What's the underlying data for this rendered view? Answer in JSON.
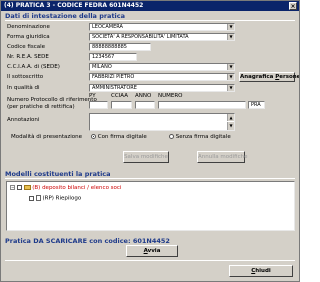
{
  "window": {
    "title": "(4) PRATICA 3 - CODICE FEDRA 601N4452",
    "close_glyph": "×"
  },
  "section_intestazione": {
    "title": "Dati di intestazione della pratica"
  },
  "form": {
    "denominazione": {
      "label": "Denominazione",
      "value": "LEOCAMERA"
    },
    "forma_giuridica": {
      "label": "Forma giuridica",
      "value": "SOCIETA' A RESPONSABILITA' LIMITATA"
    },
    "codice_fiscale": {
      "label": "Codice fiscale",
      "value": "88888888885"
    },
    "rea": {
      "label": "Nr. R.E.A. SEDE",
      "value": "1234567"
    },
    "cciaa": {
      "label": "C.C.I.A.A. di (SEDE)",
      "value": "MILANO"
    },
    "sottoscrittore": {
      "label": "Il sottoscritto",
      "value": "FABBRIZI PIETRO"
    },
    "qualita": {
      "label": "In qualità di",
      "value": "AMMINISTRATORE"
    },
    "protocollo": {
      "label_line1": "Numero Protocollo di riferimento",
      "label_line2": "(per pratiche di rettifica)",
      "col_py": "PY",
      "col_cciaa": "CCIAA",
      "col_anno": "ANNO",
      "col_numero": "NUMERO",
      "type_value": "PRA"
    },
    "annotazioni": {
      "label": "Annotazioni",
      "value": ""
    },
    "modalita": {
      "label": "Modalità di presentazione",
      "opt_firma": "Con firma digitale",
      "opt_senza": "Senza firma digitale",
      "selected": "Con firma digitale"
    }
  },
  "buttons": {
    "anagrafica": {
      "text_before": "Anagrafica ",
      "text_u": "P",
      "text_after": "ersone"
    },
    "salva": "Salva modifiche",
    "annulla": "Annulla modifiche",
    "avvia_u": "A",
    "avvia_rest": "vvia",
    "chiudi_u": "C",
    "chiudi_rest": "hiudi"
  },
  "section_modelli": {
    "title": "Modelli costituenti la pratica",
    "tree": [
      {
        "label": "(B) deposito bilanci / elenco soci",
        "color": "#cc0000"
      },
      {
        "label": "(RP) Riepilogo",
        "color": "#000000"
      }
    ]
  },
  "footer": {
    "status_text": "Pratica DA SCARICARE con codice: 601N4452"
  }
}
